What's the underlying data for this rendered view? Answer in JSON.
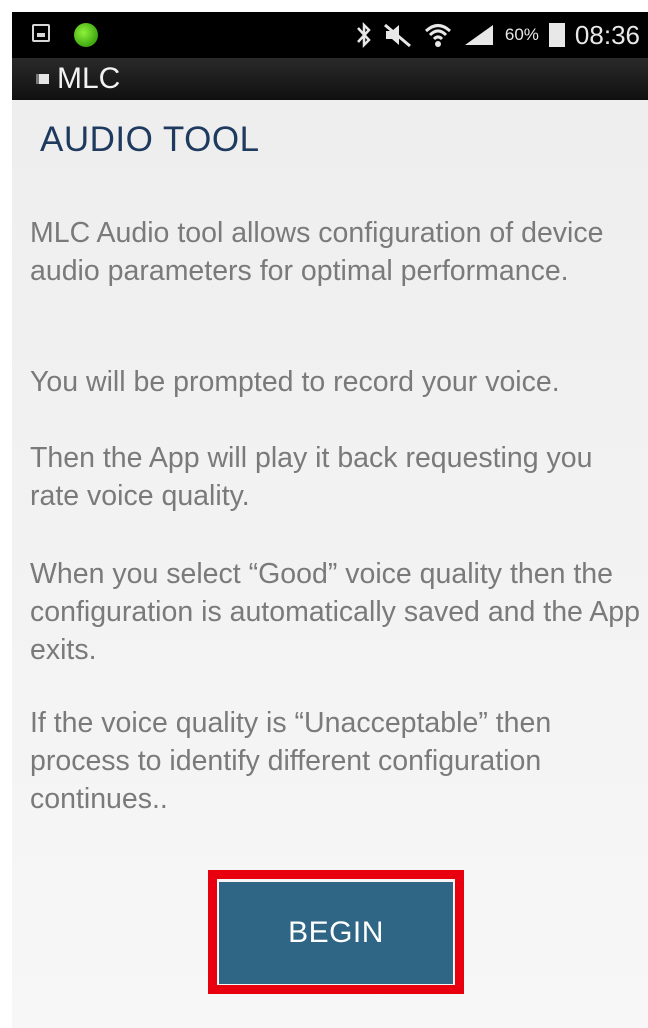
{
  "status_bar": {
    "battery_percent": "60%",
    "time": "08:36",
    "icons": [
      "screenshot-icon",
      "green-dot-icon",
      "bluetooth-icon",
      "mute-icon",
      "wifi-icon",
      "signal-icon",
      "battery-icon"
    ]
  },
  "app_bar": {
    "title": "MLC"
  },
  "screen": {
    "heading": "AUDIO TOOL",
    "paragraphs": [
      "MLC Audio tool allows configuration of device audio parameters for optimal performance.",
      "You will be prompted to record your voice.",
      "Then the App will play it back requesting you rate voice quality.",
      "When you select “Good” voice quality then the configuration is automatically saved and the App exits.",
      "If the voice quality is “Unacceptable” then process to identify different configuration continues.."
    ],
    "begin_label": "BEGIN"
  },
  "colors": {
    "heading": "#1e3a5f",
    "body_text": "#7a7a7a",
    "button_bg": "#2f6686",
    "highlight": "#e8000f"
  }
}
